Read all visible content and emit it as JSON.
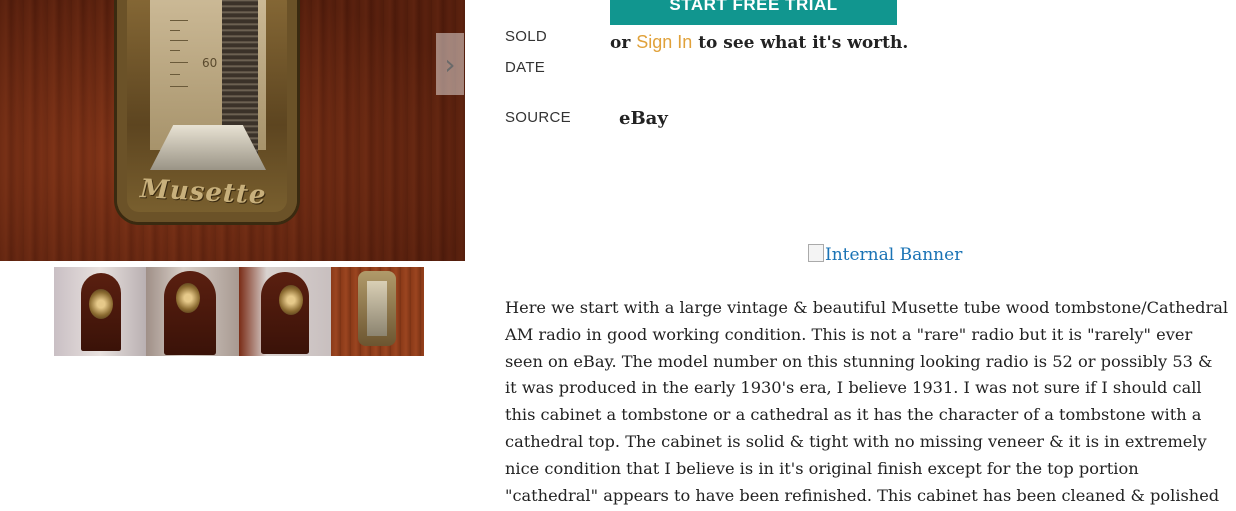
{
  "gallery": {
    "main_image_badge": "Musette",
    "dial_number": "60",
    "next_icon": "chevron-right-icon",
    "thumbnails": [
      "thumbnail-front",
      "thumbnail-angle",
      "thumbnail-side",
      "thumbnail-dial"
    ]
  },
  "details": {
    "sold_date_label_line1": "SOLD",
    "sold_date_label_line2": "DATE",
    "trial_button_label": "START FREE TRIAL",
    "sold_prefix": "or",
    "signin_link": "Sign In",
    "sold_suffix": "to see what it's worth.",
    "source_label": "SOURCE",
    "source_value": "eBay"
  },
  "banner": {
    "alt_text": "Internal Banner"
  },
  "description": {
    "lines": [
      "Here we start with a large vintage & beautiful Musette tube wood tombstone/Cathedral",
      "AM radio in good working condition. This is not a \"rare\" radio but it is \"rarely\" ever",
      "seen on eBay. The model number on this stunning looking radio is 52 or possibly 53 &",
      "it was produced in the early 1930's era, I believe 1931. I was not sure if I should call",
      "this cabinet a tombstone or a cathedral as it has the character of a tombstone with a",
      "cathedral top. The cabinet is solid & tight with no missing veneer & it is in extremely",
      "nice condition that I believe is in it's original finish except for the top portion",
      "\"cathedral\" appears to have been refinished. This cabinet has been cleaned & polished"
    ]
  },
  "colors": {
    "accent_teal": "#11968f",
    "link_orange": "#e0a13a",
    "banner_link_blue": "#1a73b5"
  }
}
